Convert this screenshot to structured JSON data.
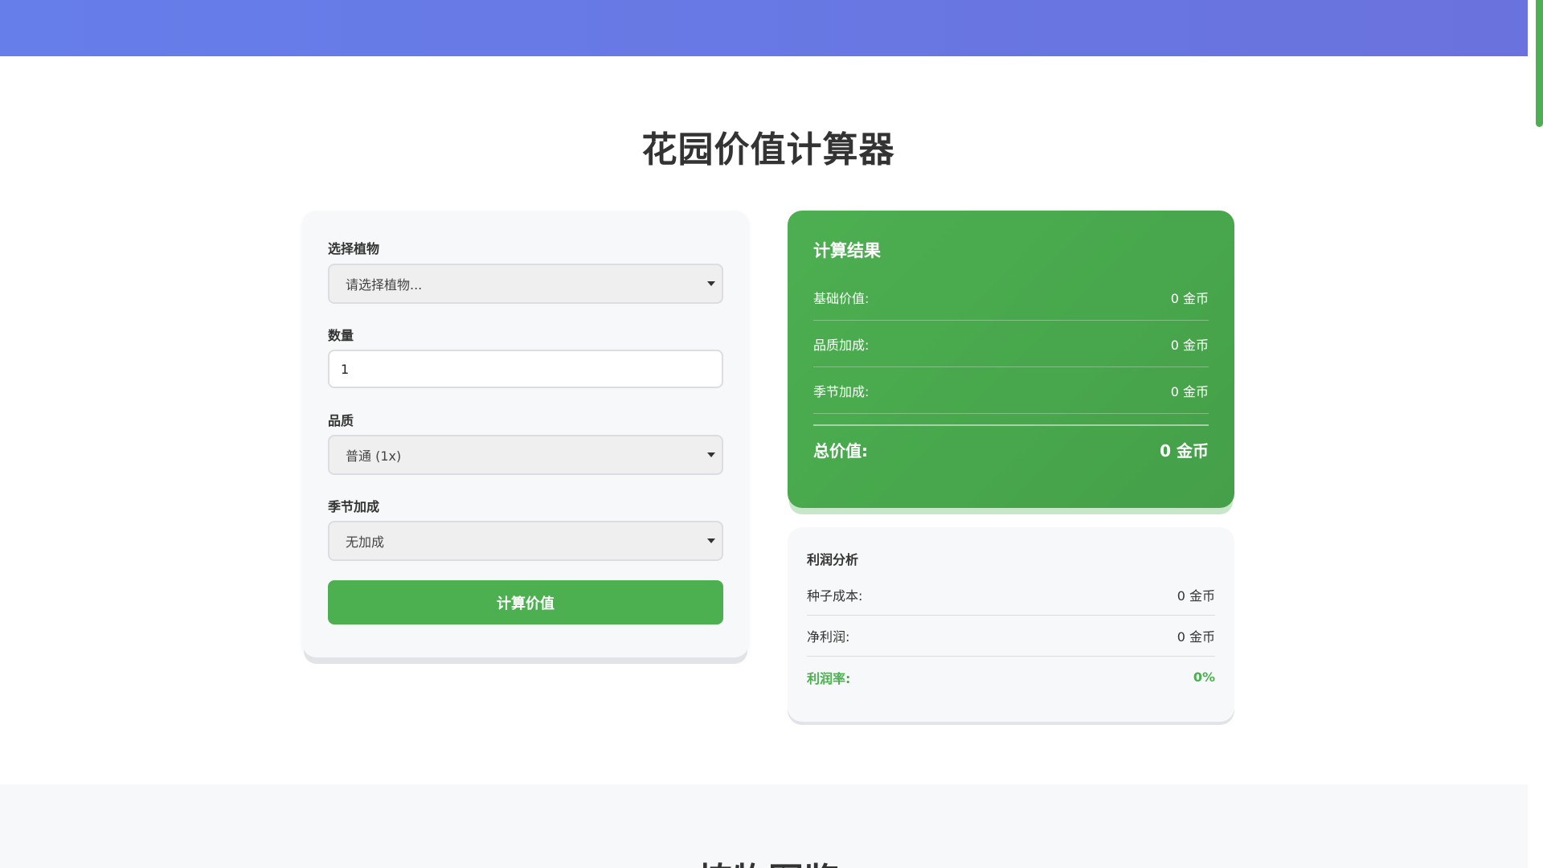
{
  "page": {
    "title": "花园价值计算器",
    "next_section_title": "植物图鉴"
  },
  "form": {
    "plant_label": "选择植物",
    "plant_value": "请选择植物...",
    "quantity_label": "数量",
    "quantity_value": "1",
    "quality_label": "品质",
    "quality_value": "普通 (1x)",
    "season_label": "季节加成",
    "season_value": "无加成",
    "calculate_button": "计算价值"
  },
  "result": {
    "title": "计算结果",
    "rows": [
      {
        "label": "基础价值:",
        "value": "0 金币"
      },
      {
        "label": "品质加成:",
        "value": "0 金币"
      },
      {
        "label": "季节加成:",
        "value": "0 金币"
      }
    ],
    "total_label": "总价值:",
    "total_value": "0 金币"
  },
  "profit": {
    "title": "利润分析",
    "rows": [
      {
        "label": "种子成本:",
        "value": "0 金币"
      },
      {
        "label": "净利润:",
        "value": "0 金币"
      },
      {
        "label": "利润率:",
        "value": "0%"
      }
    ]
  },
  "colors": {
    "header_gradient_start": "#667eea",
    "accent_green": "#4caf50",
    "card_bg": "#f7f8f9"
  }
}
